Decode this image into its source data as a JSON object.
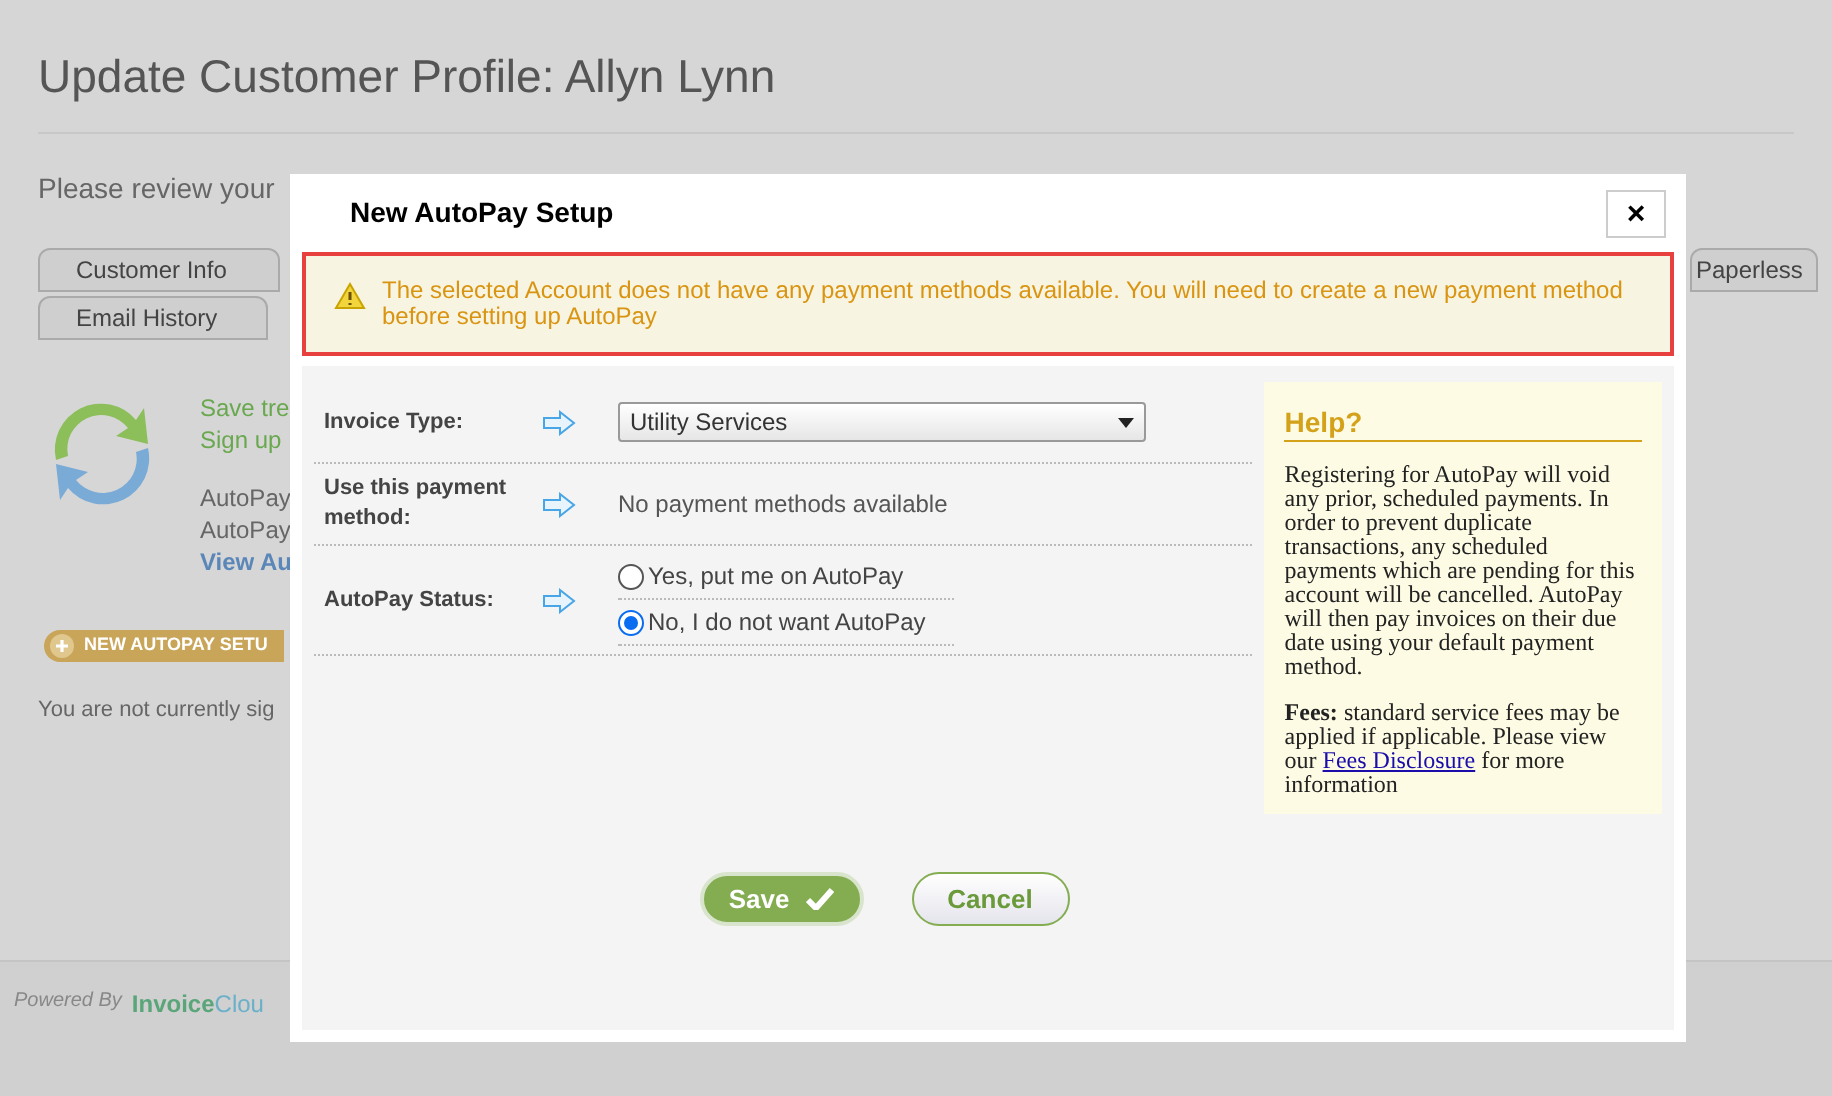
{
  "page": {
    "title": "Update Customer Profile: Allyn Lynn",
    "intro": "Please review your",
    "tabs": [
      {
        "label": "Customer Info",
        "selected": false
      },
      {
        "label": "Email History",
        "selected": false
      },
      {
        "label": "Paperless",
        "selected": false
      }
    ],
    "promo": [
      "Save tre",
      "Sign up"
    ],
    "info": [
      "AutoPay",
      "AutoPay"
    ],
    "view_link": "View Au",
    "new_button": "NEW AUTOPAY SETU",
    "status_text": "You are not currently sig",
    "footer": {
      "powered_by": "Powered By",
      "brand_bold": "Invoice",
      "brand_light": "Clou"
    }
  },
  "dialog": {
    "title": "New AutoPay Setup",
    "close": "×",
    "alert": "The selected Account does not have any payment methods available. You will need to create a new payment method before setting up AutoPay",
    "fields": [
      {
        "kind": "select",
        "label": "Invoice Type:",
        "value": "Utility Services"
      },
      {
        "kind": "text",
        "label": "Use this payment method:",
        "value": "No payment methods available"
      },
      {
        "kind": "radio",
        "label": "AutoPay Status:",
        "options": [
          {
            "label": "Yes, put me on AutoPay",
            "selected": false
          },
          {
            "label": "No, I do not want AutoPay",
            "selected": true
          }
        ]
      }
    ],
    "help": {
      "title": "Help?",
      "body": "Registering for AutoPay will void any prior, scheduled payments. In order to prevent duplicate transactions, any scheduled payments which are pending for this account will be cancelled. AutoPay will then pay invoices on their due date using your default payment method.",
      "fees_label": "Fees:",
      "fees_text": "standard service fees may be applied if applicable. Please view our",
      "link": "Fees Disclosure",
      "after_link": "for more information"
    },
    "buttons": {
      "save": "Save",
      "cancel": "Cancel"
    }
  }
}
